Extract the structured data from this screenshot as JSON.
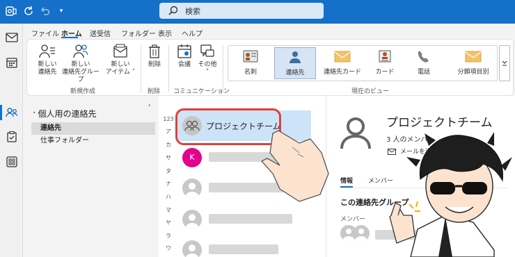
{
  "search": {
    "placeholder": "検索"
  },
  "menu": {
    "tabs": [
      "ファイル",
      "ホーム",
      "送受信",
      "フォルダー",
      "表示",
      "ヘルプ"
    ],
    "active": "ホーム"
  },
  "ribbon": {
    "new_contact": [
      "新しい",
      "連絡先"
    ],
    "new_group": [
      "新しい",
      "連絡先グループ"
    ],
    "new_item": [
      "新しい",
      "アイテム ˅"
    ],
    "group_new": "新規作成",
    "delete": "削除",
    "group_delete": "削除",
    "meeting": "会議",
    "other": [
      "その他",
      "˅"
    ],
    "group_comm": "コミュニケーション",
    "views": [
      "名刺",
      "連絡先",
      "連絡先カード",
      "カード",
      "電話",
      "分類項目別"
    ],
    "group_view": "現在のビュー"
  },
  "folders": {
    "header": "個人用の連絡先",
    "items": [
      "連絡先",
      "仕事フォルダー"
    ],
    "collapse": "‹"
  },
  "list": {
    "alpha": [
      "123",
      "ア",
      "カ",
      "サ",
      "タ",
      "ナ",
      "ハ",
      "マ",
      "ヤ",
      "ラ",
      "ワ"
    ],
    "selected_name": "プロジェクトチーム",
    "k_initial": "K"
  },
  "detail": {
    "title": "プロジェクトチーム",
    "count": "3 人のメンバー",
    "send_mail": "メールを送信",
    "tab_info": "情報",
    "tab_members": "メンバー",
    "section": "この連絡先グループ",
    "members_label": "メンバー"
  },
  "colors": {
    "accent": "#1470c8",
    "highlight": "#e0403a",
    "selected_row": "#cde3f7",
    "k_avatar": "#e3008c"
  }
}
